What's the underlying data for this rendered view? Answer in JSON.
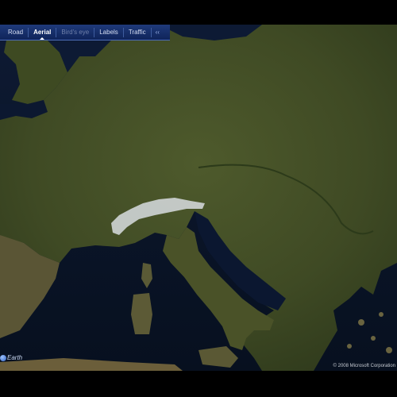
{
  "toolbar": {
    "road": "Road",
    "aerial": "Aerial",
    "birds_eye": "Bird's eye",
    "labels": "Labels",
    "traffic": "Traffic",
    "collapse": "‹‹"
  },
  "active_view": "Aerial",
  "copyright": "© 2008 Microsoft Corporation",
  "logo_text": "Earth",
  "icons": [
    "collapse-chevron-icon",
    "globe-logo-icon"
  ]
}
